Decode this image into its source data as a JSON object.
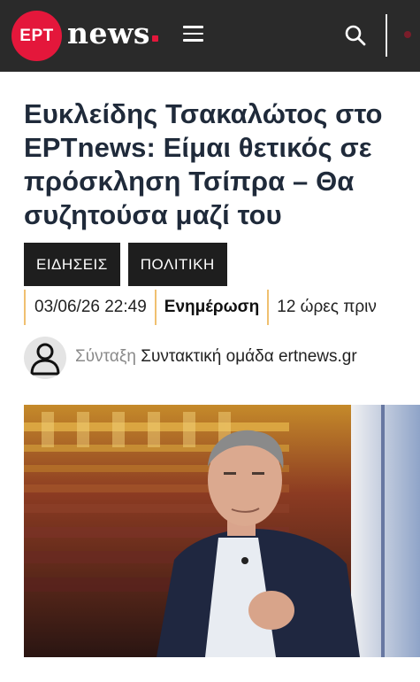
{
  "header": {
    "logo_badge": "ΕΡΤ",
    "logo_word": "news",
    "accent_color": "#e4173b",
    "menu_icon": "hamburger-menu-icon",
    "search_icon": "search-icon"
  },
  "article": {
    "title": "Ευκλείδης Τσακαλώτος στο ΕΡΤnews: Είμαι θετικός σε πρόσκληση Τσίπρα – Θα συζητούσα μαζί του",
    "tags": [
      "ΕΙΔΗΣΕΙΣ",
      "ΠΟΛΙΤΙΚΗ"
    ],
    "date": "03/06/26 22:49",
    "update_label": "Ενημέρωση",
    "relative_time": "12 ώρες πριν",
    "author_label": "Σύνταξη",
    "author_name": "Συντακτική ομάδα ertnews.gr"
  }
}
